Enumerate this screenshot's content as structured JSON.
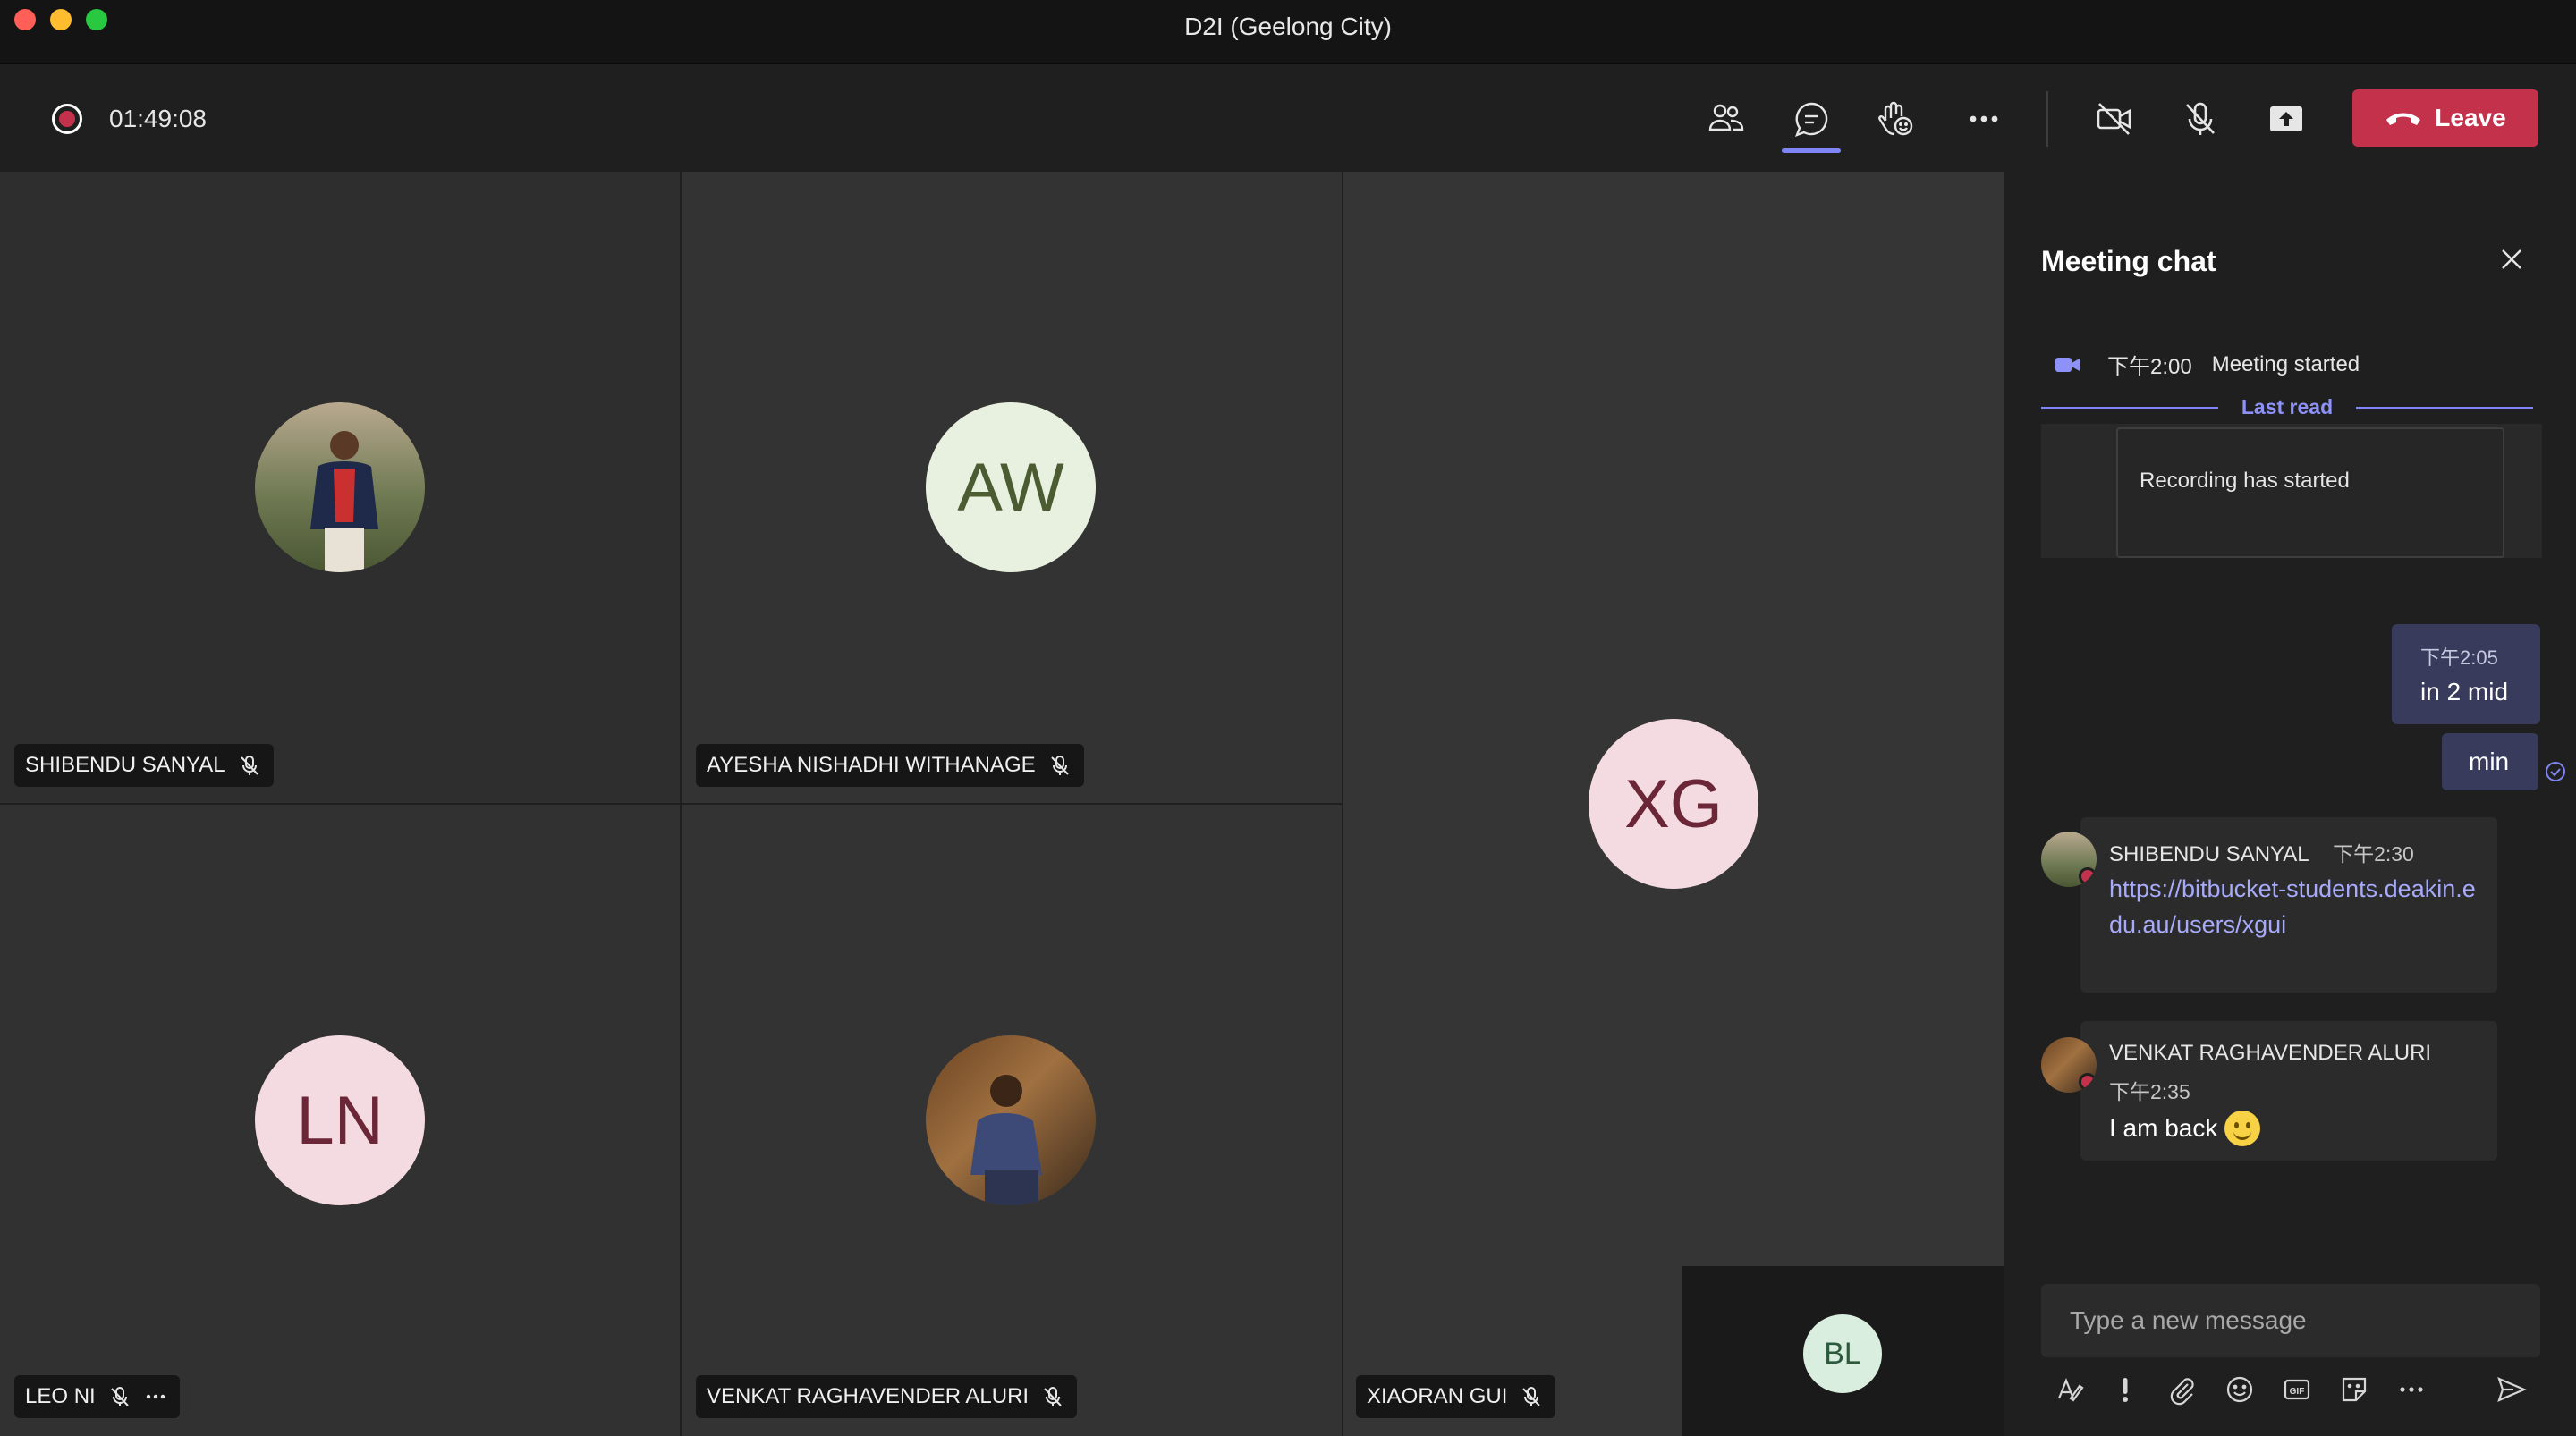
{
  "window": {
    "title": "D2I (Geelong City)"
  },
  "toolbar": {
    "timer": "01:49:08",
    "leave_label": "Leave",
    "icons": [
      "participants-icon",
      "chat-icon",
      "raise-hand-icon",
      "more-actions-icon",
      "camera-off-icon",
      "mic-off-icon",
      "share-screen-icon"
    ]
  },
  "participants": [
    {
      "name": "SHIBENDU SANYAL",
      "avatar": "photo",
      "muted": true
    },
    {
      "name": "AYESHA NISHADHI WITHANAGE",
      "initials": "AW",
      "muted": true
    },
    {
      "name": "XIAORAN GUI",
      "initials": "XG",
      "muted": true
    },
    {
      "name": "LEO NI",
      "initials": "LN",
      "muted": true
    },
    {
      "name": "VENKAT RAGHAVENDER ALURI",
      "avatar": "photo",
      "muted": true
    }
  ],
  "self_view": {
    "initials": "BL"
  },
  "chat": {
    "title": "Meeting chat",
    "system_time": "下午2:00",
    "system_text": "Meeting started",
    "last_read": "Last read",
    "recording_text": "Recording has started",
    "self_messages": [
      {
        "time": "下午2:05",
        "text": "in 2 mid"
      },
      {
        "text": "min"
      }
    ],
    "messages": [
      {
        "sender": "SHIBENDU SANYAL",
        "time": "下午2:30",
        "text": "https://bitbucket-students.deakin.edu.au/users/xgui"
      },
      {
        "sender": "VENKAT RAGHAVENDER ALURI",
        "time": "下午2:35",
        "text": "I am back"
      }
    ],
    "compose_placeholder": "Type a new message"
  },
  "colors": {
    "accent": "#7f85f5",
    "leave": "#c4314b",
    "self_bubble": "#393b5c"
  }
}
